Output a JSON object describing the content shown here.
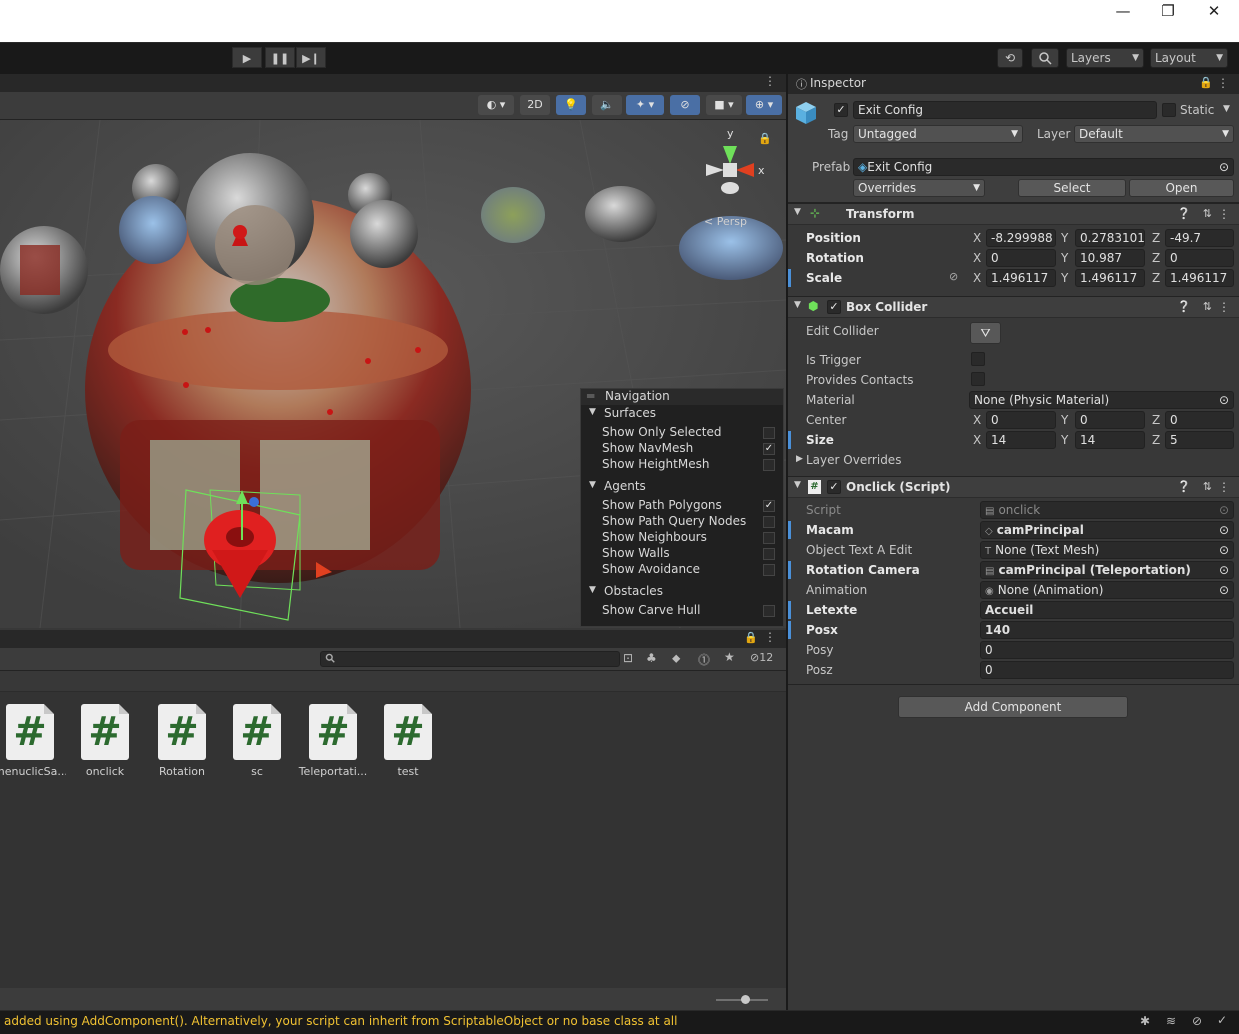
{
  "window": {
    "minimize": "—",
    "restore": "❐",
    "close": "✕"
  },
  "toolbar": {
    "layers": "Layers",
    "layout": "Layout",
    "play": "▶",
    "pause": "❚❚",
    "step": "▶❙"
  },
  "scene": {
    "toggle_2d": "2D",
    "axis_x": "x",
    "axis_y": "y",
    "persp": "< Persp"
  },
  "navigation": {
    "title": "Navigation",
    "sections": [
      {
        "name": "Surfaces",
        "items": [
          {
            "label": "Show Only Selected",
            "checked": false
          },
          {
            "label": "Show NavMesh",
            "checked": true
          },
          {
            "label": "Show HeightMesh",
            "checked": false
          }
        ]
      },
      {
        "name": "Agents",
        "items": [
          {
            "label": "Show Path Polygons",
            "checked": true
          },
          {
            "label": "Show Path Query Nodes",
            "checked": false
          },
          {
            "label": "Show Neighbours",
            "checked": false
          },
          {
            "label": "Show Walls",
            "checked": false
          },
          {
            "label": "Show Avoidance",
            "checked": false
          }
        ]
      },
      {
        "name": "Obstacles",
        "items": [
          {
            "label": "Show Carve Hull",
            "checked": false
          }
        ]
      }
    ]
  },
  "project": {
    "hidden_count": "12",
    "assets": [
      "menuclicSa...",
      "onclick",
      "Rotation",
      "sc",
      "Teleportati...",
      "test"
    ]
  },
  "status": {
    "message": "added using AddComponent(). Alternatively, your script can inherit from ScriptableObject or no base class at all"
  },
  "inspector": {
    "tab": "Inspector",
    "object_name": "Exit Config",
    "static_label": "Static",
    "tag_label": "Tag",
    "tag_value": "Untagged",
    "layer_label": "Layer",
    "layer_value": "Default",
    "prefab_label": "Prefab",
    "prefab_value": "Exit Config",
    "overrides": "Overrides",
    "select": "Select",
    "open": "Open",
    "transform": {
      "title": "Transform",
      "position_label": "Position",
      "position": {
        "x": "-8.299988",
        "y": "0.2783101",
        "z": "-49.7"
      },
      "rotation_label": "Rotation",
      "rotation": {
        "x": "0",
        "y": "10.987",
        "z": "0"
      },
      "scale_label": "Scale",
      "scale": {
        "x": "1.496117",
        "y": "1.496117",
        "z": "1.496117"
      }
    },
    "box_collider": {
      "title": "Box Collider",
      "edit_collider": "Edit Collider",
      "is_trigger": "Is Trigger",
      "provides_contacts": "Provides Contacts",
      "material_label": "Material",
      "material_value": "None (Physic Material)",
      "center_label": "Center",
      "center": {
        "x": "0",
        "y": "0",
        "z": "0"
      },
      "size_label": "Size",
      "size": {
        "x": "14",
        "y": "14",
        "z": "5"
      },
      "layer_overrides": "Layer Overrides"
    },
    "onclick": {
      "title": "Onclick (Script)",
      "fields": [
        {
          "label": "Script",
          "value": "onclick",
          "bold": false,
          "icon": "script"
        },
        {
          "label": "Macam",
          "value": "camPrincipal",
          "bold": true,
          "icon": "gameobject"
        },
        {
          "label": "Object Text A Edit",
          "value": "None (Text Mesh)",
          "bold": false,
          "icon": "textmesh"
        },
        {
          "label": "Rotation Camera",
          "value": "camPrincipal (Teleportation)",
          "bold": true,
          "icon": "script"
        },
        {
          "label": "Animation",
          "value": "None (Animation)",
          "bold": false,
          "icon": "animation"
        },
        {
          "label": "Letexte",
          "value": "Accueil",
          "bold": true,
          "icon": ""
        },
        {
          "label": "Posx",
          "value": "140",
          "bold": true,
          "icon": ""
        },
        {
          "label": "Posy",
          "value": "0",
          "bold": false,
          "icon": ""
        },
        {
          "label": "Posz",
          "value": "0",
          "bold": false,
          "icon": ""
        }
      ]
    },
    "add_component": "Add Component"
  },
  "colors": {
    "accent": "#4a90d9",
    "status_text": "#f1c232",
    "script_icon": "#2c6a2f"
  }
}
